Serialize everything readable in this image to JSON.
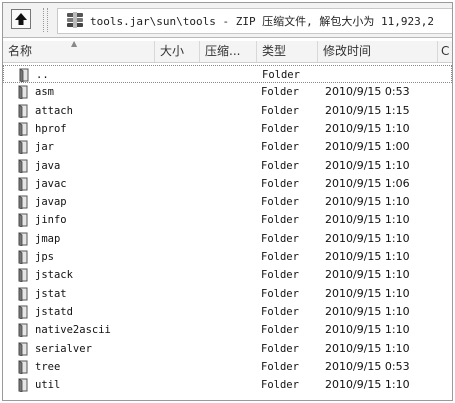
{
  "path_bar": {
    "up_icon": "up-arrow-icon",
    "archive_icon": "winrar-archive-icon",
    "path_text": "tools.jar\\sun\\tools - ZIP 压缩文件, 解包大小为 11,923,2"
  },
  "columns": {
    "name": "名称",
    "size": "大小",
    "packed": "压缩...",
    "type": "类型",
    "modified": "修改时间",
    "extra": "C"
  },
  "rows": [
    {
      "name": "..",
      "type": "Folder",
      "modified": ""
    },
    {
      "name": "asm",
      "type": "Folder",
      "modified": "2010/9/15 0:53"
    },
    {
      "name": "attach",
      "type": "Folder",
      "modified": "2010/9/15 1:15"
    },
    {
      "name": "hprof",
      "type": "Folder",
      "modified": "2010/9/15 1:10"
    },
    {
      "name": "jar",
      "type": "Folder",
      "modified": "2010/9/15 1:00"
    },
    {
      "name": "java",
      "type": "Folder",
      "modified": "2010/9/15 1:10"
    },
    {
      "name": "javac",
      "type": "Folder",
      "modified": "2010/9/15 1:06"
    },
    {
      "name": "javap",
      "type": "Folder",
      "modified": "2010/9/15 1:10"
    },
    {
      "name": "jinfo",
      "type": "Folder",
      "modified": "2010/9/15 1:10"
    },
    {
      "name": "jmap",
      "type": "Folder",
      "modified": "2010/9/15 1:10"
    },
    {
      "name": "jps",
      "type": "Folder",
      "modified": "2010/9/15 1:10"
    },
    {
      "name": "jstack",
      "type": "Folder",
      "modified": "2010/9/15 1:10"
    },
    {
      "name": "jstat",
      "type": "Folder",
      "modified": "2010/9/15 1:10"
    },
    {
      "name": "jstatd",
      "type": "Folder",
      "modified": "2010/9/15 1:10"
    },
    {
      "name": "native2ascii",
      "type": "Folder",
      "modified": "2010/9/15 1:10"
    },
    {
      "name": "serialver",
      "type": "Folder",
      "modified": "2010/9/15 1:10"
    },
    {
      "name": "tree",
      "type": "Folder",
      "modified": "2010/9/15 0:53"
    },
    {
      "name": "util",
      "type": "Folder",
      "modified": "2010/9/15 1:10"
    }
  ]
}
